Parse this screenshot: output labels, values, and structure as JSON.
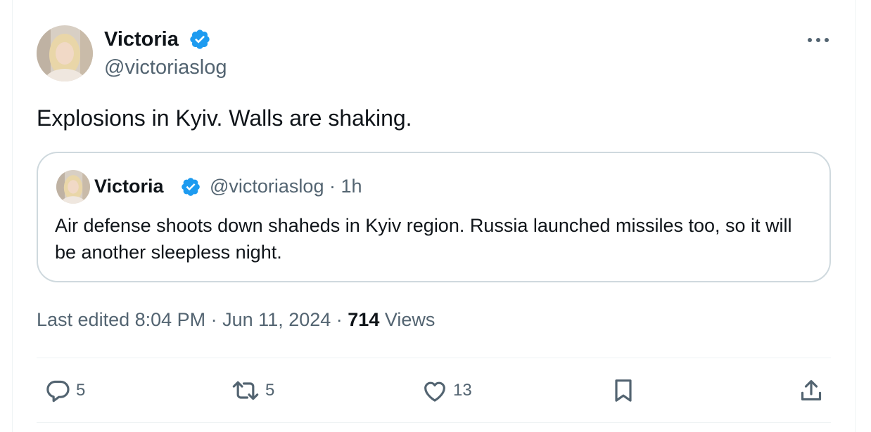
{
  "colors": {
    "text_primary": "#0f1419",
    "text_secondary": "#536471",
    "verified_badge": "#1d9bf0",
    "border": "#cfd9de",
    "divider": "#eff3f4"
  },
  "tweet": {
    "author": {
      "name": "Victoria",
      "handle": "@victoriaslog",
      "verified_icon": "verified-badge-icon",
      "avatar_icon": "avatar"
    },
    "more_icon": "more-options-icon",
    "text": "Explosions in Kyiv. Walls are shaking.",
    "quote": {
      "author_name": "Victoria",
      "meta": "@victoriaslog · 1h",
      "text": "Air defense shoots down shaheds in Kyiv region. Russia launched missiles too, so it will be another sleepless night."
    },
    "meta": {
      "edited": "Last edited 8:04 PM · Jun 11, 2024 · ",
      "views_count": "714",
      "views_label": " Views"
    },
    "actions": {
      "reply": {
        "icon": "reply-icon",
        "count": "5"
      },
      "retweet": {
        "icon": "retweet-icon",
        "count": "5"
      },
      "like": {
        "icon": "heart-icon",
        "count": "13"
      },
      "bookmark": {
        "icon": "bookmark-icon"
      },
      "share": {
        "icon": "share-icon"
      }
    }
  }
}
